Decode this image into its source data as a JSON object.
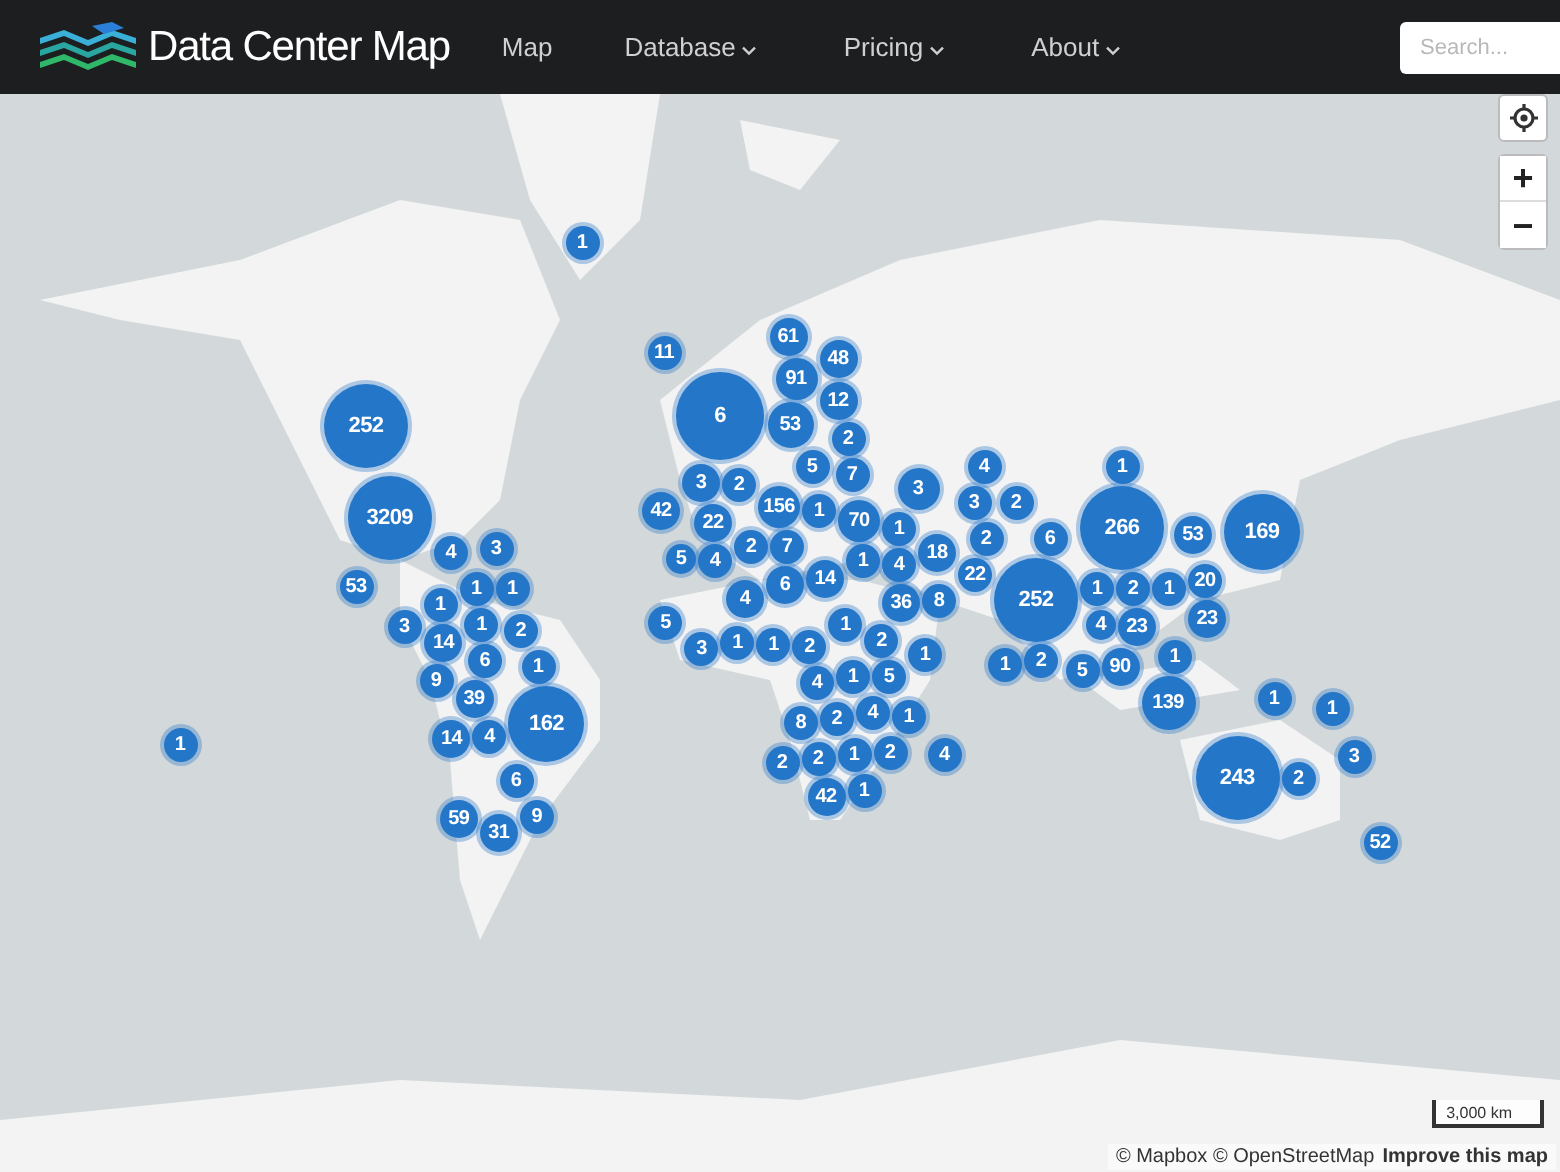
{
  "header": {
    "logo": "Data Center Map",
    "nav": [
      {
        "label": "Map",
        "dropdown": false
      },
      {
        "label": "Database",
        "dropdown": true
      },
      {
        "label": "Pricing",
        "dropdown": true
      },
      {
        "label": "About",
        "dropdown": true
      }
    ],
    "search": {
      "placeholder": "Search..."
    }
  },
  "map": {
    "kind": "picture",
    "zoom_in": "+",
    "zoom_out": "−",
    "scale": "3,000 km",
    "attribution": "© Mapbox © OpenStreetMap",
    "improve_link": "Improve this map",
    "clusters": [
      {
        "count": "1"
      },
      {
        "count": "11"
      },
      {
        "count": "61"
      },
      {
        "count": "91"
      },
      {
        "count": "48"
      },
      {
        "count": "252"
      },
      {
        "count": "6"
      },
      {
        "count": "53"
      },
      {
        "count": "12"
      },
      {
        "count": "2"
      },
      {
        "count": "3"
      },
      {
        "count": "2"
      },
      {
        "count": "5"
      },
      {
        "count": "7"
      },
      {
        "count": "42"
      },
      {
        "count": "22"
      },
      {
        "count": "156"
      },
      {
        "count": "1"
      },
      {
        "count": "5"
      },
      {
        "count": "4"
      },
      {
        "count": "2"
      },
      {
        "count": "7"
      },
      {
        "count": "4"
      },
      {
        "count": "6"
      },
      {
        "count": "70"
      },
      {
        "count": "14"
      },
      {
        "count": "3"
      },
      {
        "count": "1"
      },
      {
        "count": "1"
      },
      {
        "count": "4"
      },
      {
        "count": "18"
      },
      {
        "count": "36"
      },
      {
        "count": "8"
      },
      {
        "count": "4"
      },
      {
        "count": "3"
      },
      {
        "count": "2"
      },
      {
        "count": "2"
      },
      {
        "count": "22"
      },
      {
        "count": "6"
      },
      {
        "count": "252"
      },
      {
        "count": "1"
      },
      {
        "count": "1"
      },
      {
        "count": "266"
      },
      {
        "count": "53"
      },
      {
        "count": "169"
      },
      {
        "count": "2"
      },
      {
        "count": "1"
      },
      {
        "count": "20"
      },
      {
        "count": "4"
      },
      {
        "count": "23"
      },
      {
        "count": "23"
      },
      {
        "count": "1"
      },
      {
        "count": "2"
      },
      {
        "count": "5"
      },
      {
        "count": "90"
      },
      {
        "count": "1"
      },
      {
        "count": "139"
      },
      {
        "count": "1"
      },
      {
        "count": "1"
      },
      {
        "count": "3"
      },
      {
        "count": "243"
      },
      {
        "count": "2"
      },
      {
        "count": "52"
      },
      {
        "count": "1"
      },
      {
        "count": "3209"
      },
      {
        "count": "4"
      },
      {
        "count": "3"
      },
      {
        "count": "53"
      },
      {
        "count": "1"
      },
      {
        "count": "1"
      },
      {
        "count": "1"
      },
      {
        "count": "3"
      },
      {
        "count": "14"
      },
      {
        "count": "1"
      },
      {
        "count": "2"
      },
      {
        "count": "9"
      },
      {
        "count": "39"
      },
      {
        "count": "6"
      },
      {
        "count": "1"
      },
      {
        "count": "14"
      },
      {
        "count": "4"
      },
      {
        "count": "162"
      },
      {
        "count": "6"
      },
      {
        "count": "59"
      },
      {
        "count": "31"
      },
      {
        "count": "9"
      },
      {
        "count": "5"
      },
      {
        "count": "3"
      },
      {
        "count": "1"
      },
      {
        "count": "1"
      },
      {
        "count": "2"
      },
      {
        "count": "1"
      },
      {
        "count": "2"
      },
      {
        "count": "1"
      },
      {
        "count": "4"
      },
      {
        "count": "1"
      },
      {
        "count": "5"
      },
      {
        "count": "8"
      },
      {
        "count": "2"
      },
      {
        "count": "4"
      },
      {
        "count": "1"
      },
      {
        "count": "2"
      },
      {
        "count": "2"
      },
      {
        "count": "1"
      },
      {
        "count": "2"
      },
      {
        "count": "4"
      },
      {
        "count": "42"
      },
      {
        "count": "1"
      }
    ]
  }
}
